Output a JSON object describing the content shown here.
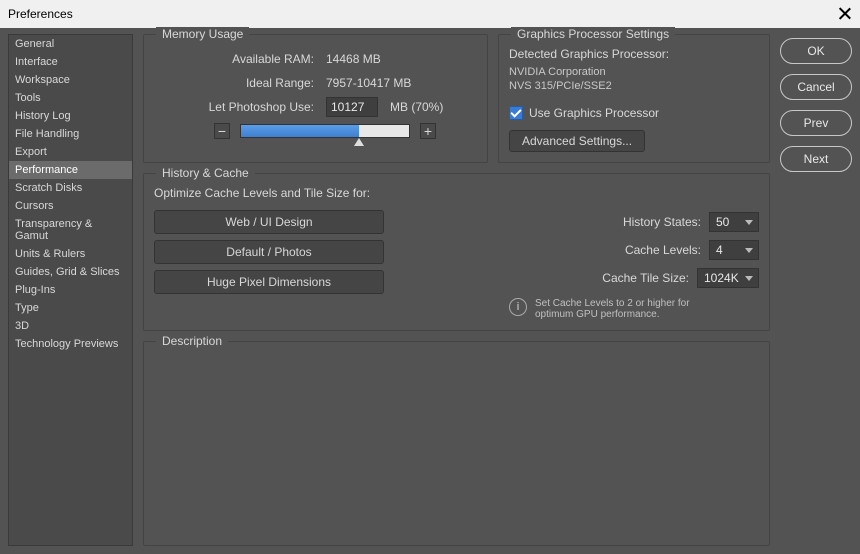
{
  "dialog": {
    "title": "Preferences"
  },
  "sidebar": {
    "items": [
      "General",
      "Interface",
      "Workspace",
      "Tools",
      "History Log",
      "File Handling",
      "Export",
      "Performance",
      "Scratch Disks",
      "Cursors",
      "Transparency & Gamut",
      "Units & Rulers",
      "Guides, Grid & Slices",
      "Plug-Ins",
      "Type",
      "3D",
      "Technology Previews"
    ],
    "selected_index": 7
  },
  "buttons": {
    "ok": "OK",
    "cancel": "Cancel",
    "prev": "Prev",
    "next": "Next"
  },
  "memory": {
    "legend": "Memory Usage",
    "available_label": "Available RAM:",
    "available_value": "14468 MB",
    "ideal_label": "Ideal Range:",
    "ideal_value": "7957-10417 MB",
    "use_label": "Let Photoshop Use:",
    "use_value": "10127",
    "use_suffix": "MB (70%)",
    "minus": "−",
    "plus": "+"
  },
  "graphics": {
    "legend": "Graphics Processor Settings",
    "detected_label": "Detected Graphics Processor:",
    "vendor": "NVIDIA Corporation",
    "device": "NVS 315/PCIe/SSE2",
    "use_gpu": "Use Graphics Processor",
    "advanced": "Advanced Settings..."
  },
  "history": {
    "legend": "History & Cache",
    "optimize_text": "Optimize Cache Levels and Tile Size for:",
    "btn1": "Web / UI Design",
    "btn2": "Default / Photos",
    "btn3": "Huge Pixel Dimensions",
    "history_states_label": "History States:",
    "history_states_value": "50",
    "cache_levels_label": "Cache Levels:",
    "cache_levels_value": "4",
    "cache_tile_label": "Cache Tile Size:",
    "cache_tile_value": "1024K",
    "info": "Set Cache Levels to 2 or higher for optimum GPU performance.",
    "info_i": "i"
  },
  "description": {
    "legend": "Description"
  }
}
